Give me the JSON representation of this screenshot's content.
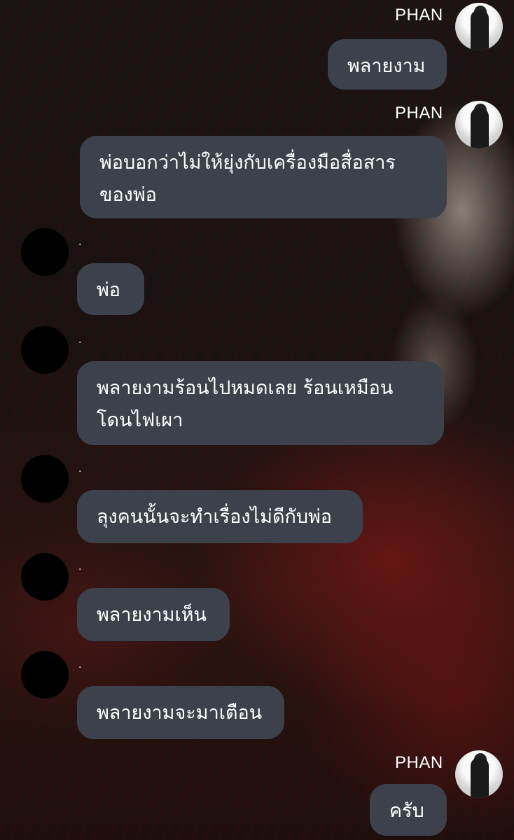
{
  "sender_name": "PHAN",
  "sender_dot": ".",
  "messages": [
    {
      "from": "user",
      "text": "พลายงาม"
    },
    {
      "from": "user",
      "text": "พ่อบอกว่าไม่ให้ยุ่งกับเครื่องมือสื่อสาร\nของพ่อ"
    },
    {
      "from": "other",
      "text": "พ่อ"
    },
    {
      "from": "other",
      "text": "พลายงามร้อนไปหมดเลย ร้อนเหมือน\nโดนไฟเผา"
    },
    {
      "from": "other",
      "text": "ลุงคนนั้นจะทำเรื่องไม่ดีกับพ่อ"
    },
    {
      "from": "other",
      "text": "พลายงามเห็น"
    },
    {
      "from": "other",
      "text": "พลายงามจะมาเตือน"
    },
    {
      "from": "user",
      "text": "ครับ"
    }
  ]
}
